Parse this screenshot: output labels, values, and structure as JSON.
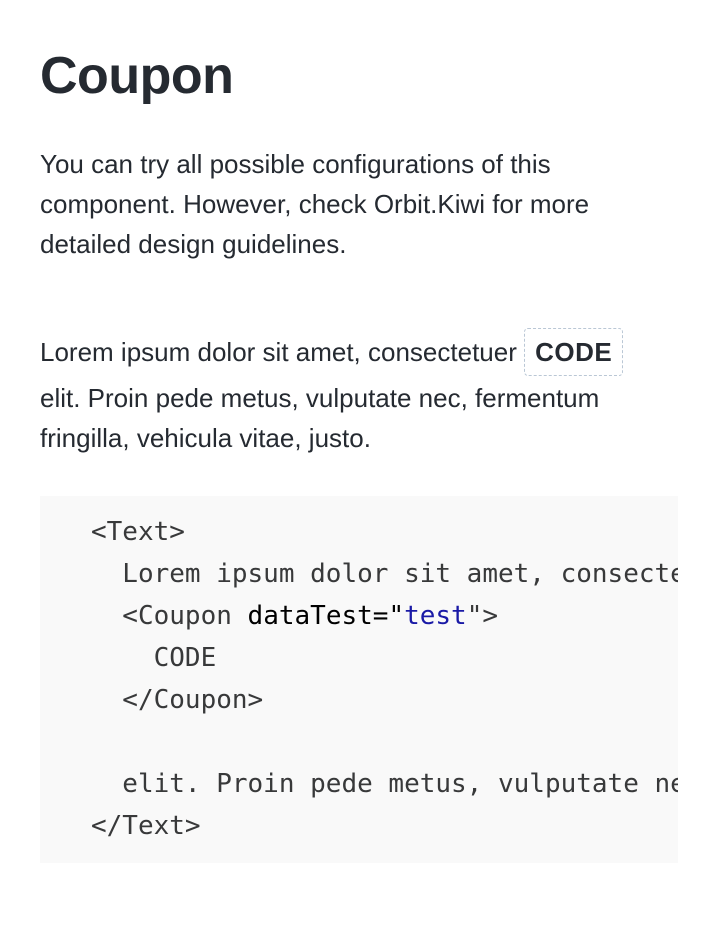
{
  "header": {
    "title": "Coupon"
  },
  "intro": {
    "text": "You can try all possible configurations of this component. However, check Orbit.Kiwi for more detailed design guidelines."
  },
  "demo": {
    "line1_before": "Lorem ipsum dolor sit amet, consectetuer ",
    "coupon_label": "CODE",
    "line2": "elit. Proin pede metus, vulputate nec, fermentum",
    "line3": "fringilla, vehicula vitae, justo."
  },
  "code": {
    "line1": "<Text>",
    "line2": "  Lorem ipsum dolor sit amet, consectetuer",
    "line3_tag": "  <Coupon ",
    "line3_attr": "dataTest=",
    "line3_q1": "\"",
    "line3_value": "test",
    "line3_q2": "\">",
    "line4": "    CODE",
    "line5": "  </Coupon>",
    "line6": "",
    "line7": "  elit. Proin pede metus, vulputate nec, fermentum",
    "line8": "</Text>"
  }
}
